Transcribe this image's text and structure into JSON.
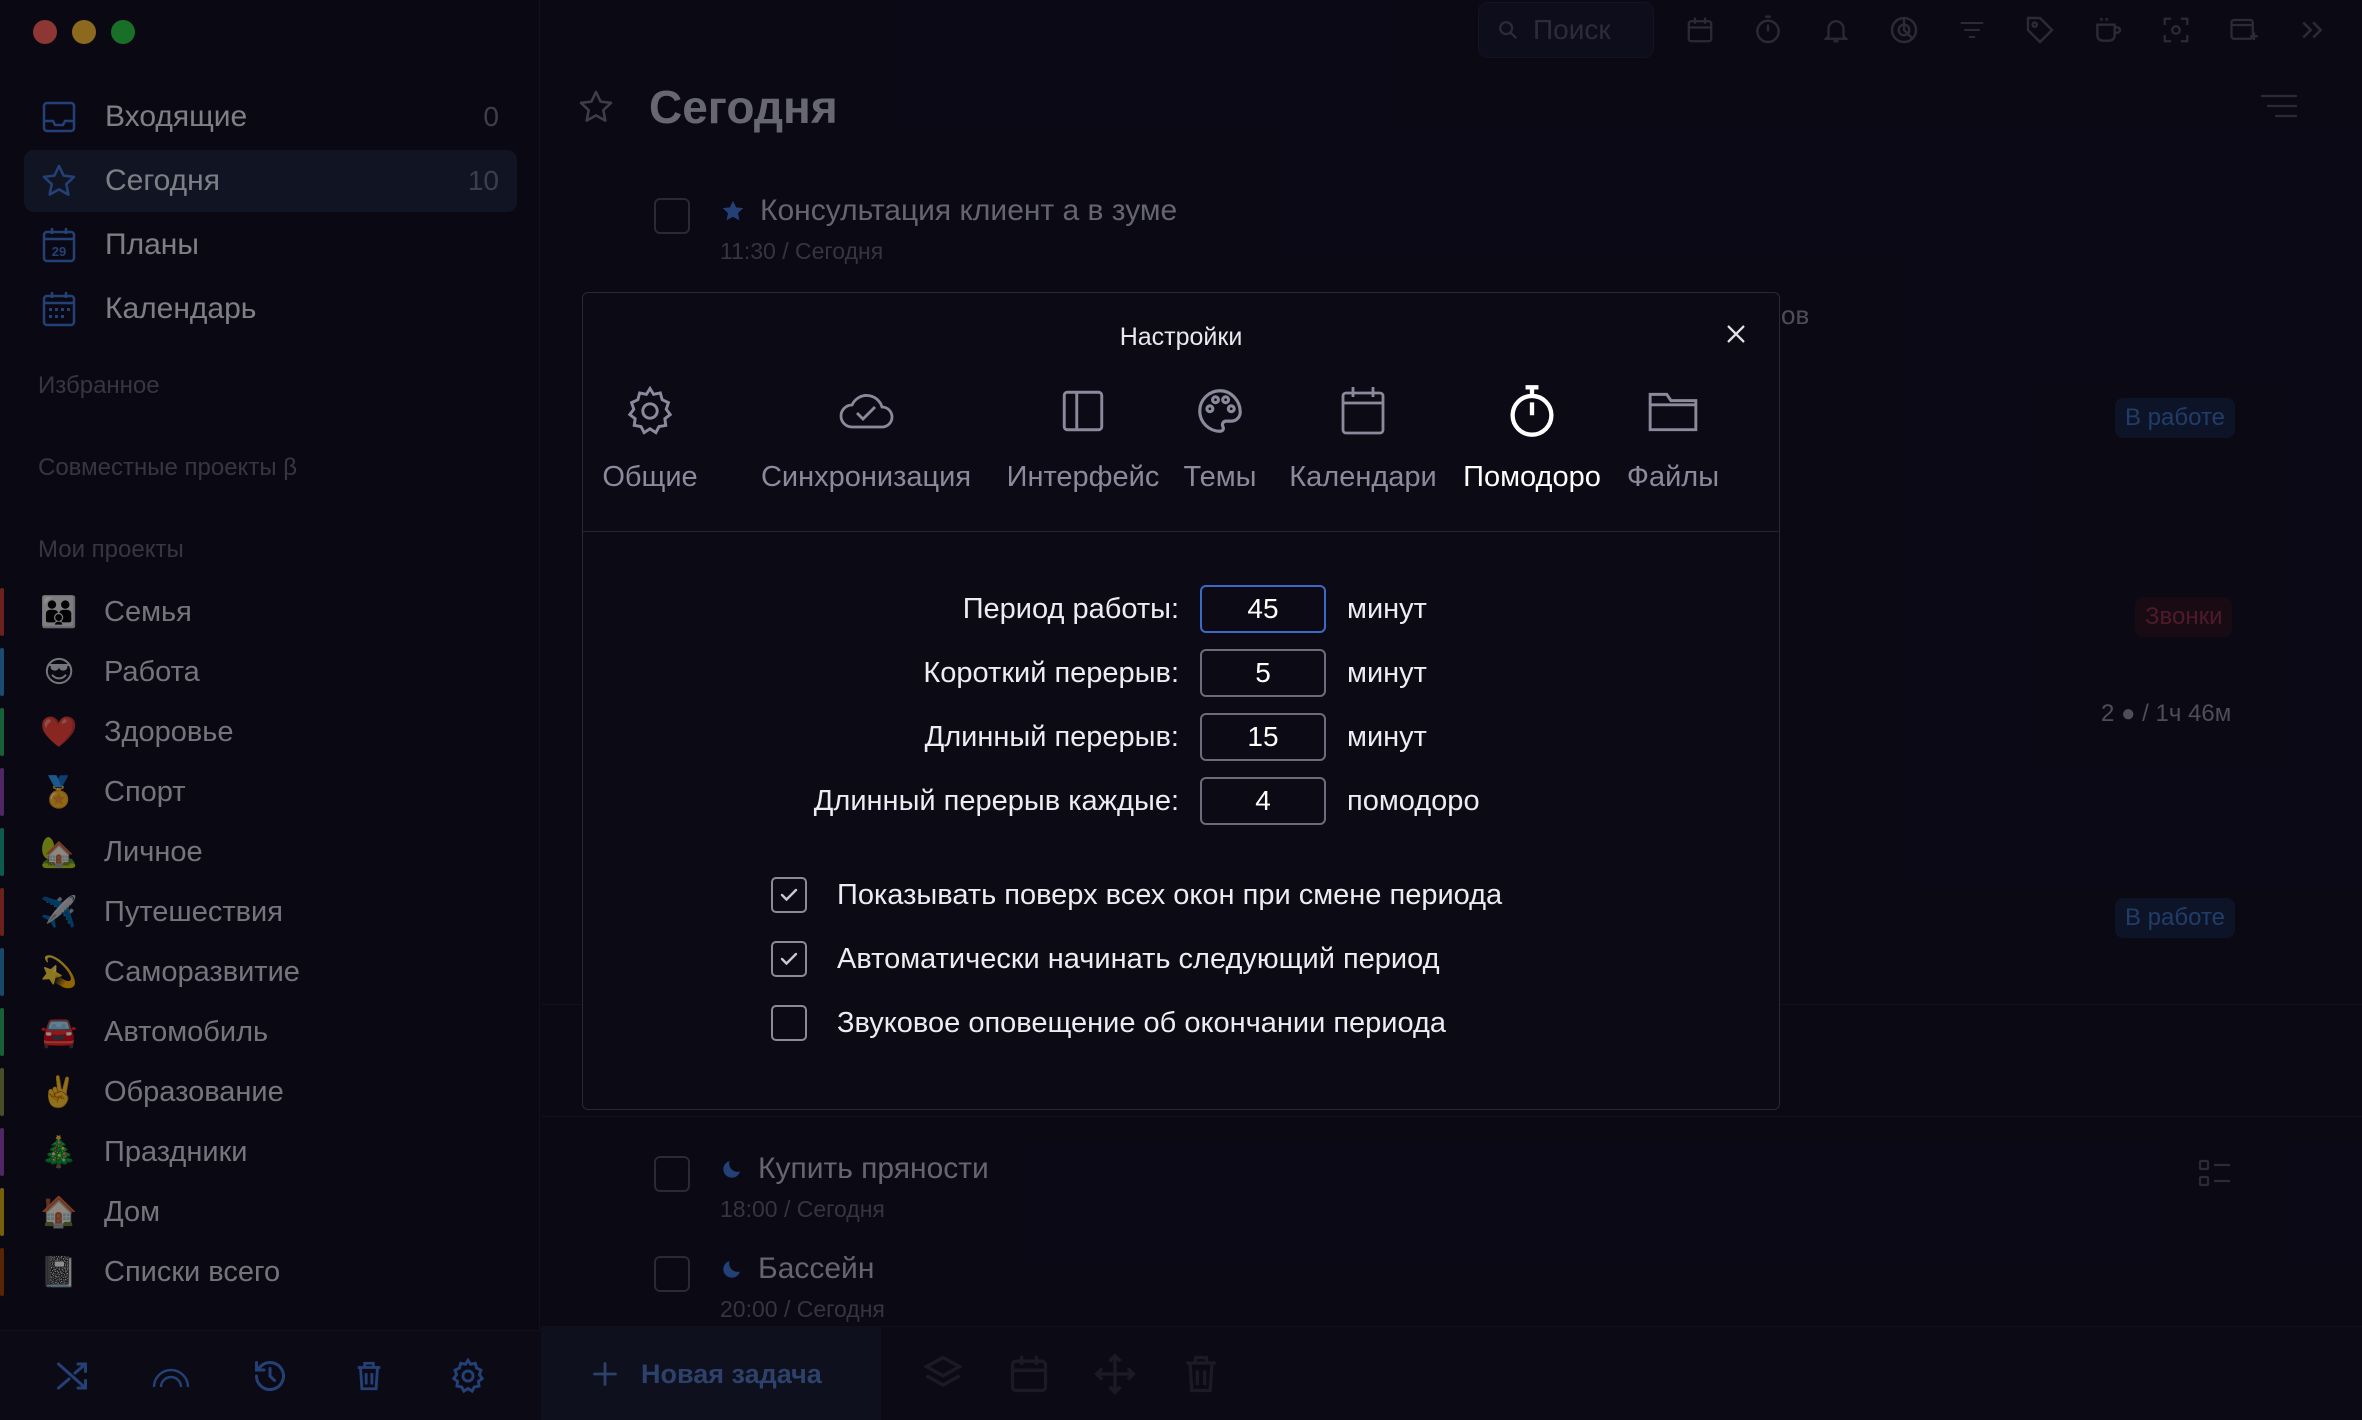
{
  "sidebar": {
    "nav": [
      {
        "label": "Входящие",
        "count": "0",
        "icon": "inbox-icon"
      },
      {
        "label": "Сегодня",
        "count": "10",
        "icon": "star-icon"
      },
      {
        "label": "Планы",
        "count": "",
        "icon": "calendar-29-icon"
      },
      {
        "label": "Календарь",
        "count": "",
        "icon": "calendar-grid-icon"
      }
    ],
    "favorites_title": "Избранное",
    "shared_title": "Совместные проекты β",
    "projects_title": "Мои проекты",
    "projects": [
      {
        "label": "Семья",
        "emoji": "👪",
        "color": "#c0392b"
      },
      {
        "label": "Работа",
        "emoji": "😎",
        "color": "#2e86c1"
      },
      {
        "label": "Здоровье",
        "emoji": "❤️",
        "color": "#27ae60"
      },
      {
        "label": "Спорт",
        "emoji": "🏅",
        "color": "#8e44ad"
      },
      {
        "label": "Личное",
        "emoji": "🏡",
        "color": "#16a085"
      },
      {
        "label": "Путешествия",
        "emoji": "✈️",
        "color": "#c0392b"
      },
      {
        "label": "Саморазвитие",
        "emoji": "💫",
        "color": "#2980b9"
      },
      {
        "label": "Автомобиль",
        "emoji": "🚘",
        "color": "#27ae60"
      },
      {
        "label": "Образование",
        "emoji": "✌️",
        "color": "#7f8c3d"
      },
      {
        "label": "Праздники",
        "emoji": "🎄",
        "color": "#8e44ad"
      },
      {
        "label": "Дом",
        "emoji": "🏠",
        "color": "#d4ac0d"
      },
      {
        "label": "Списки всего",
        "emoji": "📓",
        "color": "#a04000"
      }
    ],
    "footer_icons": [
      "shuffle-icon",
      "rainbow-icon",
      "history-icon",
      "trash-icon",
      "gear-icon"
    ]
  },
  "toolbar": {
    "search_placeholder": "Поиск",
    "icons": [
      "calendar-icon",
      "timer-icon",
      "bell-icon",
      "stats-icon",
      "filter-icon",
      "tag-icon",
      "coffee-icon",
      "focus-icon",
      "add-window-icon",
      "expand-icon"
    ]
  },
  "main": {
    "title": "Сегодня",
    "tasks": [
      {
        "title": "Консультация клиент а в зуме",
        "subtitle": "11:30 / Сегодня",
        "marker": "star"
      },
      {
        "title": "Купить пряности",
        "subtitle": "18:00 / Сегодня",
        "marker": "moon"
      },
      {
        "title": "Бассейн",
        "subtitle": "20:00 / Сегодня",
        "marker": "moon"
      }
    ],
    "partial_text": "ов",
    "badges": {
      "in_work_1": "В работе",
      "calls": "Звонки",
      "pomodoro_stats": "2 ● / 1ч 46м",
      "in_work_2": "В работе"
    },
    "new_task_label": "Новая задача"
  },
  "settings": {
    "title": "Настройки",
    "tabs": [
      {
        "label": "Общие",
        "icon": "gear-icon",
        "active": false
      },
      {
        "label": "Синхронизация",
        "icon": "cloud-check-icon",
        "active": false
      },
      {
        "label": "Интерфейс",
        "icon": "layout-icon",
        "active": false
      },
      {
        "label": "Темы",
        "icon": "palette-icon",
        "active": false
      },
      {
        "label": "Календари",
        "icon": "calendar-icon",
        "active": false
      },
      {
        "label": "Помодоро",
        "icon": "stopwatch-icon",
        "active": true
      },
      {
        "label": "Файлы",
        "icon": "folder-icon",
        "active": false
      }
    ],
    "fields": [
      {
        "label": "Период работы:",
        "value": "45",
        "unit": "минут"
      },
      {
        "label": "Короткий перерыв:",
        "value": "5",
        "unit": "минут"
      },
      {
        "label": "Длинный перерыв:",
        "value": "15",
        "unit": "минут"
      },
      {
        "label": "Длинный перерыв каждые:",
        "value": "4",
        "unit": "помодоро"
      }
    ],
    "checkboxes": [
      {
        "label": "Показывать поверх всех окон при смене периода",
        "checked": true
      },
      {
        "label": "Автоматически начинать следующий период",
        "checked": true
      },
      {
        "label": "Звуковое оповещение об окончании периода",
        "checked": false
      }
    ]
  }
}
